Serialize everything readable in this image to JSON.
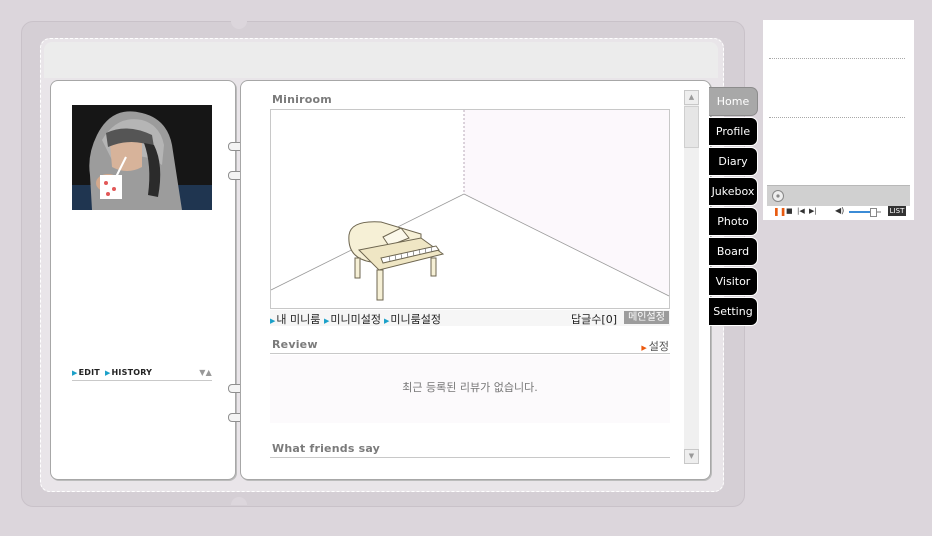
{
  "left_page": {
    "edit_label": "EDIT",
    "history_label": "HISTORY"
  },
  "miniroom": {
    "title": "Miniroom",
    "links": [
      "내 미니룸",
      "미니미설정",
      "미니룸설정"
    ],
    "reply_count": "답글수[0]",
    "main_setting": "메인설정"
  },
  "review": {
    "title": "Review",
    "setting_label": "설정",
    "empty_message": "최근 등록된 리뷰가 없습니다."
  },
  "friends": {
    "title": "What friends say"
  },
  "tabs": [
    "Home",
    "Profile",
    "Diary",
    "Jukebox",
    "Photo",
    "Board",
    "Visitor",
    "Setting"
  ],
  "active_tab": "Home",
  "player": {
    "list_label": "LIST",
    "volume": 0.75
  },
  "colors": {
    "background": "#dcd6dc",
    "tab_active": "#a8a8a8",
    "tab": "#000000",
    "link_marker": "#1aa0c8",
    "setting_marker": "#ec5a0e"
  }
}
